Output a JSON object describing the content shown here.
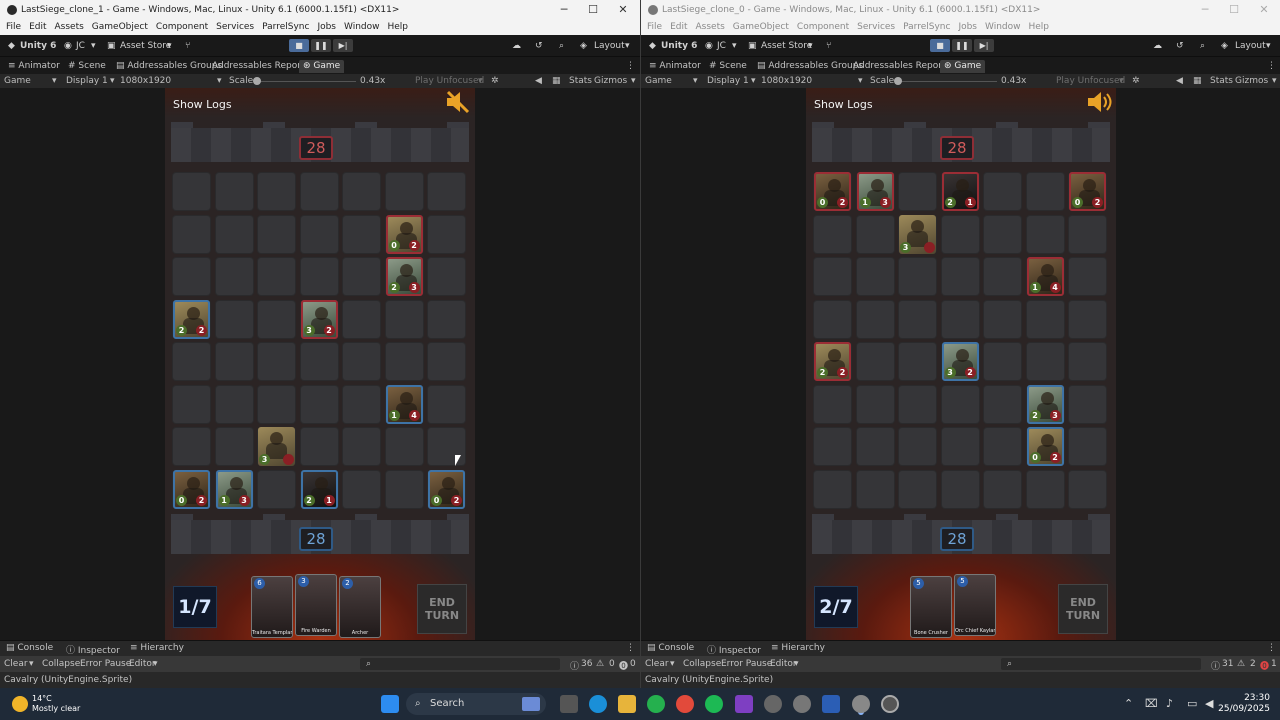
{
  "left": {
    "title": "LastSiege_clone_1 - Game - Windows, Mac, Linux - Unity 6.1 (6000.1.15f1) <DX11>",
    "top_counter": "28",
    "bottom_counter": "28",
    "mana": "1/7",
    "sound_state": "muted",
    "cards": [
      {
        "cost": "6",
        "name": "Traitara Templar"
      },
      {
        "cost": "3",
        "name": "Fire Warden"
      },
      {
        "cost": "2",
        "name": "Archer"
      }
    ],
    "units": [
      {
        "row": 1,
        "col": 5,
        "atk": "0",
        "hp": "2",
        "team": "red",
        "skin": "c1"
      },
      {
        "row": 2,
        "col": 5,
        "atk": "2",
        "hp": "3",
        "team": "red",
        "skin": "c2"
      },
      {
        "row": 3,
        "col": 0,
        "atk": "2",
        "hp": "2",
        "team": "blue",
        "skin": "c1"
      },
      {
        "row": 3,
        "col": 3,
        "atk": "3",
        "hp": "2",
        "team": "red",
        "skin": "c2"
      },
      {
        "row": 5,
        "col": 5,
        "atk": "1",
        "hp": "4",
        "team": "blue",
        "skin": "c3"
      },
      {
        "row": 6,
        "col": 2,
        "atk": "3",
        "hp": "",
        "team": "none",
        "skin": "c1"
      },
      {
        "row": 7,
        "col": 0,
        "atk": "0",
        "hp": "2",
        "team": "blue",
        "skin": "c3"
      },
      {
        "row": 7,
        "col": 1,
        "atk": "1",
        "hp": "3",
        "team": "blue",
        "skin": "c2"
      },
      {
        "row": 7,
        "col": 3,
        "atk": "2",
        "hp": "1",
        "team": "blue",
        "skin": "c4"
      },
      {
        "row": 7,
        "col": 6,
        "atk": "0",
        "hp": "2",
        "team": "blue",
        "skin": "c3"
      }
    ],
    "console_counts": {
      "logs": "36",
      "warnings": "0",
      "errors": "0"
    }
  },
  "right": {
    "title": "LastSiege_clone_0 - Game - Windows, Mac, Linux - Unity 6.1 (6000.1.15f1) <DX11>",
    "top_counter": "28",
    "bottom_counter": "28",
    "mana": "2/7",
    "sound_state": "on",
    "cards": [
      {
        "cost": "5",
        "name": "Bone Crusher"
      },
      {
        "cost": "5",
        "name": "Orc Chief Kaylar"
      }
    ],
    "units": [
      {
        "row": 0,
        "col": 0,
        "atk": "0",
        "hp": "2",
        "team": "red",
        "skin": "c3"
      },
      {
        "row": 0,
        "col": 1,
        "atk": "1",
        "hp": "3",
        "team": "red",
        "skin": "c2"
      },
      {
        "row": 0,
        "col": 3,
        "atk": "2",
        "hp": "1",
        "team": "red",
        "skin": "c4"
      },
      {
        "row": 0,
        "col": 6,
        "atk": "0",
        "hp": "2",
        "team": "red",
        "skin": "c3"
      },
      {
        "row": 1,
        "col": 2,
        "atk": "3",
        "hp": "",
        "team": "none",
        "skin": "c1"
      },
      {
        "row": 2,
        "col": 5,
        "atk": "1",
        "hp": "4",
        "team": "red",
        "skin": "c3"
      },
      {
        "row": 4,
        "col": 0,
        "atk": "2",
        "hp": "2",
        "team": "red",
        "skin": "c1"
      },
      {
        "row": 4,
        "col": 3,
        "atk": "3",
        "hp": "2",
        "team": "blue",
        "skin": "c2"
      },
      {
        "row": 5,
        "col": 5,
        "atk": "2",
        "hp": "3",
        "team": "blue",
        "skin": "c2"
      },
      {
        "row": 6,
        "col": 5,
        "atk": "0",
        "hp": "2",
        "team": "blue",
        "skin": "c1"
      }
    ],
    "console_counts": {
      "logs": "31",
      "warnings": "2",
      "errors": "1"
    }
  },
  "menu": [
    "File",
    "Edit",
    "Assets",
    "GameObject",
    "Component",
    "Services",
    "ParrelSync",
    "Jobs",
    "Window",
    "Help"
  ],
  "toolbar": {
    "unity": "Unity 6",
    "account": "JC",
    "asset_store": "Asset Store",
    "layout": "Layout"
  },
  "tabs": [
    "Animator",
    "Scene",
    "Addressables Groups",
    "Addressables Report",
    "Game"
  ],
  "gamebar": {
    "game": "Game",
    "display": "Display 1",
    "resolution": "1080x1920",
    "scale_label": "Scale",
    "scale_value": "0.43x",
    "play_mode": "Play Unfocused",
    "stats": "Stats",
    "gizmos": "Gizmos"
  },
  "game_ui": {
    "show_logs": "Show Logs",
    "end_turn": "END TURN"
  },
  "bottom_tabs": [
    "Console",
    "Inspector",
    "Hierarchy"
  ],
  "console_bar": {
    "clear": "Clear",
    "collapse": "Collapse",
    "error_pause": "Error Pause",
    "editor": "Editor"
  },
  "status_text": "Cavalry (UnityEngine.Sprite)",
  "taskbar": {
    "temp": "14°C",
    "weather": "Mostly clear",
    "search": "Search",
    "time": "23:30",
    "date": "25/09/2025"
  }
}
